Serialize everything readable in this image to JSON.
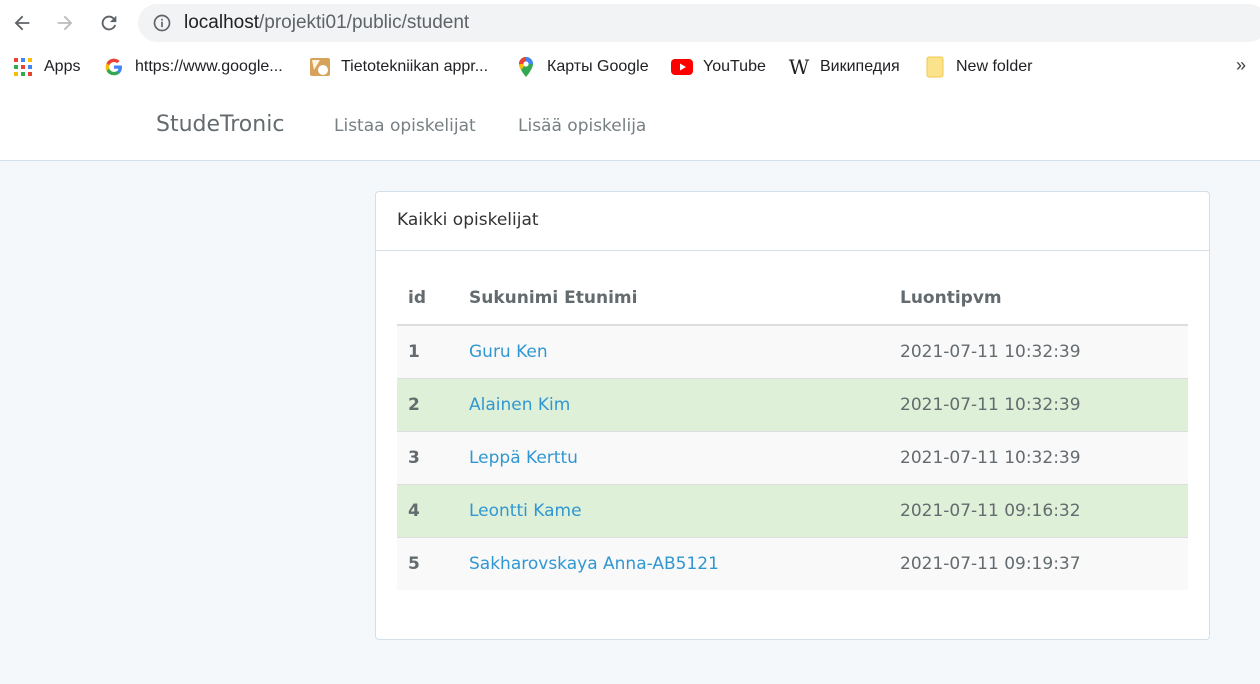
{
  "browser": {
    "url_host": "localhost",
    "url_path": "/projekti01/public/student",
    "bookmarks": [
      {
        "label": "Apps",
        "icon": "apps-grid-icon"
      },
      {
        "label": "https://www.google...",
        "icon": "google-icon"
      },
      {
        "label": "Tietotekniikan appr...",
        "icon": "bookmark-site-icon"
      },
      {
        "label": "Карты Google",
        "icon": "maps-pin-icon"
      },
      {
        "label": "YouTube",
        "icon": "youtube-icon"
      },
      {
        "label": "Википедия",
        "icon": "wikipedia-icon"
      },
      {
        "label": "New folder",
        "icon": "folder-icon"
      }
    ],
    "more_label": "»"
  },
  "navbar": {
    "brand": "StudeTronic",
    "links": [
      "Listaa opiskelijat",
      "Lisää opiskelija"
    ]
  },
  "panel": {
    "heading": "Kaikki opiskelijat",
    "columns": [
      "id",
      "Sukunimi Etunimi",
      "Luontipvm"
    ],
    "rows": [
      {
        "id": "1",
        "name": "Guru Ken",
        "created": "2021-07-11 10:32:39",
        "style": "odd"
      },
      {
        "id": "2",
        "name": "Alainen Kim",
        "created": "2021-07-11 10:32:39",
        "style": "success"
      },
      {
        "id": "3",
        "name": "Leppä Kerttu",
        "created": "2021-07-11 10:32:39",
        "style": "odd"
      },
      {
        "id": "4",
        "name": "Leontti Kame",
        "created": "2021-07-11 09:16:32",
        "style": "success"
      },
      {
        "id": "5",
        "name": "Sakharovskaya Anna-AB5121",
        "created": "2021-07-11 09:19:37",
        "style": "odd"
      }
    ]
  },
  "colors": {
    "link": "#3097d1",
    "success_row": "#dff0d8",
    "striped_row": "#f9f9f9",
    "page_bg": "#f5f8fa"
  }
}
